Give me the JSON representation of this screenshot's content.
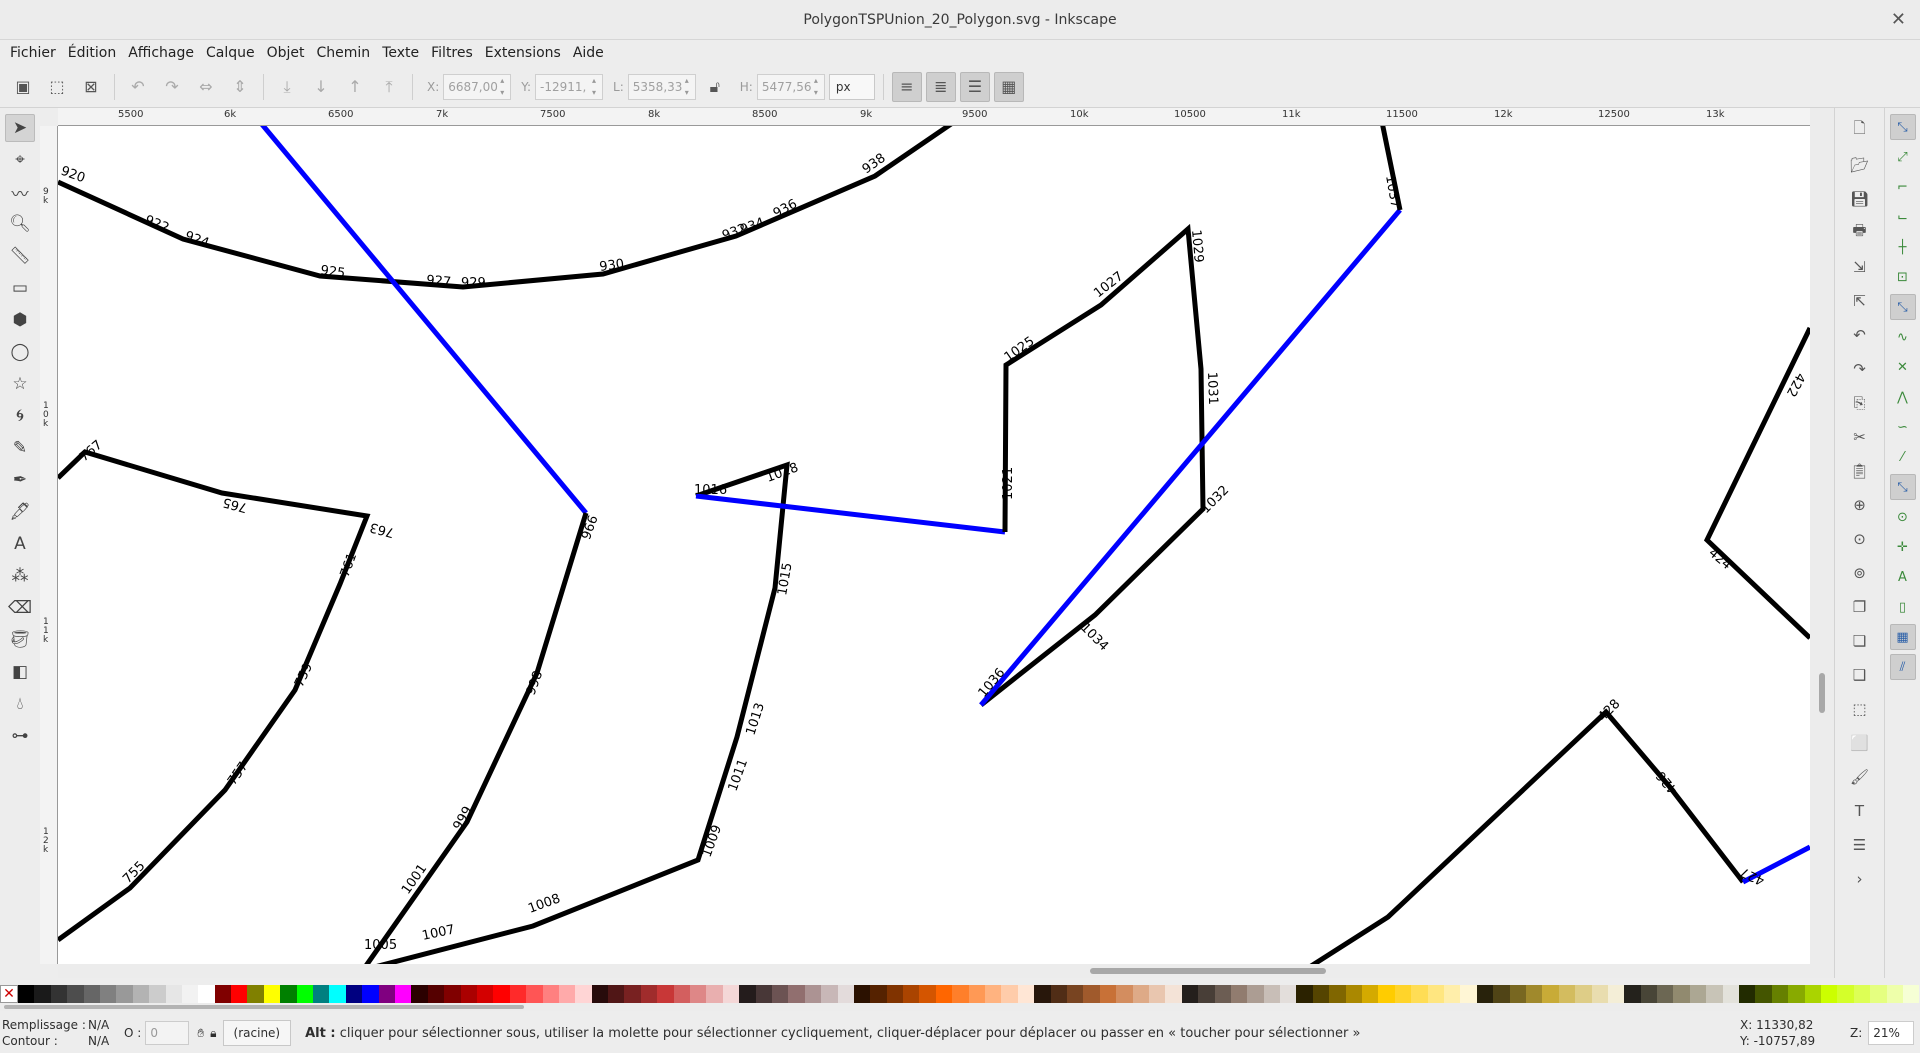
{
  "window": {
    "title": "PolygonTSPUnion_20_Polygon.svg - Inkscape",
    "close_glyph": "✕"
  },
  "menu": [
    "Fichier",
    "Édition",
    "Affichage",
    "Calque",
    "Objet",
    "Chemin",
    "Texte",
    "Filtres",
    "Extensions",
    "Aide"
  ],
  "toolctrl": {
    "x_label": "X:",
    "x_value": "6687,00",
    "y_label": "Y:",
    "y_value": "-12911,",
    "w_label": "L:",
    "w_value": "5358,33",
    "h_label": "H:",
    "h_value": "5477,56",
    "unit": "px"
  },
  "rulers": {
    "h_labels": [
      "5500",
      "6k",
      "6500",
      "7k",
      "7500",
      "8k",
      "8500",
      "9k",
      "9500",
      "10k",
      "10500",
      "11k",
      "11500",
      "12k",
      "12500",
      "13k"
    ],
    "v_labels": [
      "9k",
      "10k",
      "11k",
      "12k"
    ]
  },
  "canvas": {
    "labels": [
      "920",
      "922",
      "924",
      "925",
      "927",
      "929",
      "930",
      "932",
      "934",
      "936",
      "938",
      "1037",
      "1029",
      "1027",
      "1025",
      "1031",
      "1021",
      "1032",
      "1034",
      "1036",
      "1016",
      "1018",
      "1015",
      "1013",
      "1011",
      "1009",
      "1008",
      "1007",
      "1005",
      "1001",
      "999",
      "998",
      "996",
      "767",
      "765",
      "763",
      "761",
      "759",
      "757",
      "755",
      "422",
      "424",
      "426",
      "428",
      "427"
    ]
  },
  "status": {
    "fill_label": "Remplissage :",
    "fill_value": "N/A",
    "stroke_label": "Contour :",
    "stroke_value": "N/A",
    "opacity_label": "O :",
    "opacity_value": "0",
    "layer": "(racine)",
    "message_key": "Alt :",
    "message": " cliquer pour sélectionner sous, utiliser la molette pour sélectionner cycliquement, cliquer-déplacer pour déplacer ou passer en « toucher pour sélectionner »",
    "cursor_x": "X: 11330,82",
    "cursor_y": "Y: -10757,89",
    "zoom_label": "Z:",
    "zoom_value": "21%"
  },
  "colors": {
    "path_black": "#000000",
    "path_blue": "#0000ff"
  }
}
